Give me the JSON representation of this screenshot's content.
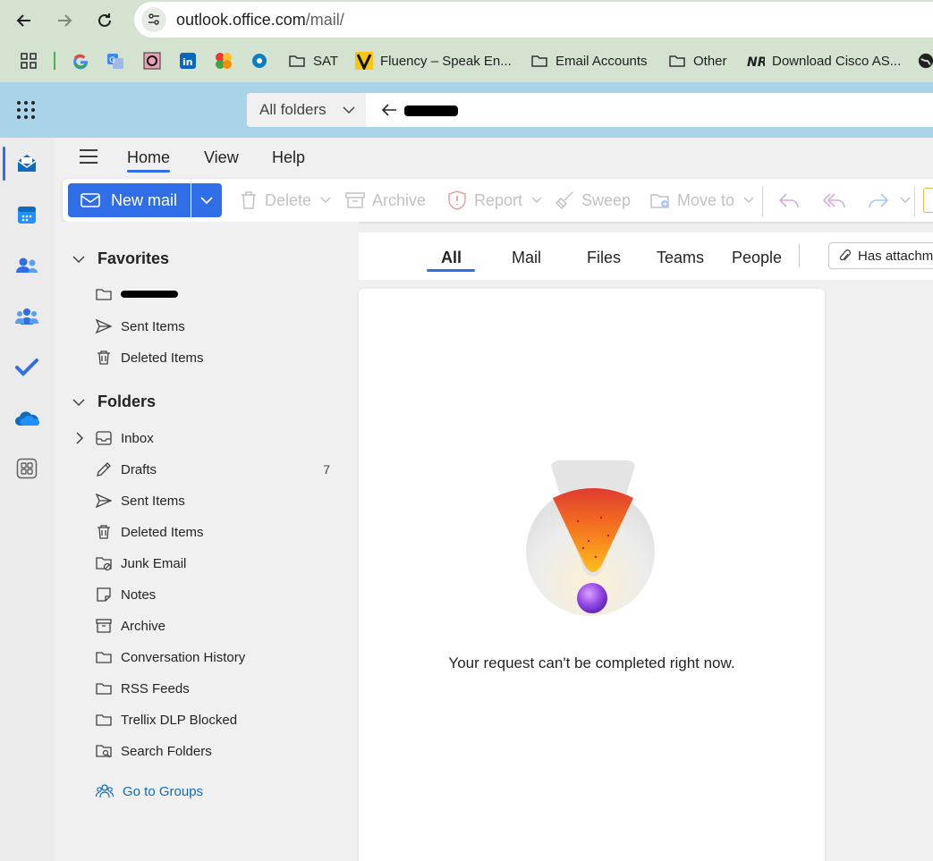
{
  "browser": {
    "url_host": "outlook.office.com",
    "url_path": "/mail/",
    "bookmarks": [
      {
        "label": "SAT",
        "icon": "folder-icon"
      },
      {
        "label": "Fluency – Speak En...",
        "icon": "fluency-logo-icon"
      },
      {
        "label": "Email Accounts",
        "icon": "folder-icon"
      },
      {
        "label": "Other",
        "icon": "folder-icon"
      },
      {
        "label": "Download Cisco AS...",
        "icon": "nr-logo-icon"
      }
    ]
  },
  "header": {
    "folder_scope": "All folders"
  },
  "ribbon": {
    "tabs": [
      "Home",
      "View",
      "Help"
    ],
    "active_tab": "Home"
  },
  "toolbar": {
    "new_mail": "New mail",
    "delete": "Delete",
    "archive": "Archive",
    "report": "Report",
    "sweep": "Sweep",
    "move_to": "Move to"
  },
  "favorites": {
    "title": "Favorites",
    "items": [
      "Sent Items",
      "Deleted Items"
    ]
  },
  "folders": {
    "title": "Folders",
    "items": [
      {
        "label": "Inbox",
        "count": ""
      },
      {
        "label": "Drafts",
        "count": "7"
      },
      {
        "label": "Sent Items",
        "count": ""
      },
      {
        "label": "Deleted Items",
        "count": ""
      },
      {
        "label": "Junk Email",
        "count": ""
      },
      {
        "label": "Notes",
        "count": ""
      },
      {
        "label": "Archive",
        "count": ""
      },
      {
        "label": "Conversation History",
        "count": ""
      },
      {
        "label": "RSS Feeds",
        "count": ""
      },
      {
        "label": "Trellix DLP Blocked",
        "count": ""
      },
      {
        "label": "Search Folders",
        "count": ""
      }
    ],
    "go_to_groups": "Go to Groups"
  },
  "filters": {
    "tabs": [
      "All",
      "Mail",
      "Files",
      "Teams",
      "People"
    ],
    "active": "All",
    "has_attachments": "Has attachme"
  },
  "message_area": {
    "error": "Your request can't be completed right now."
  },
  "colors": {
    "accent": "#2f6ee6",
    "header_bg": "#a9d3e8",
    "browser_bg": "#d3e3cf"
  }
}
